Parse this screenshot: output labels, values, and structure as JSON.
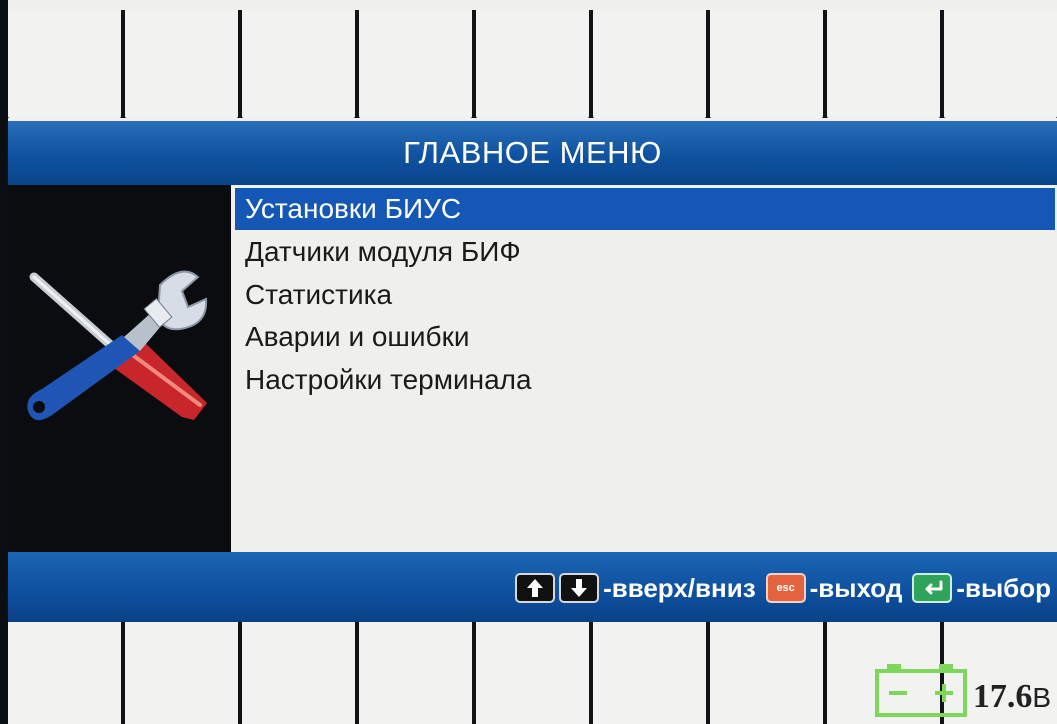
{
  "header": {
    "title": "ГЛАВНОЕ МЕНЮ"
  },
  "menu": {
    "items": [
      {
        "label": "Установки БИУС",
        "selected": true
      },
      {
        "label": "Датчики модуля БИФ",
        "selected": false
      },
      {
        "label": "Статистика",
        "selected": false
      },
      {
        "label": "Аварии и ошибки",
        "selected": false
      },
      {
        "label": "Настройки терминала",
        "selected": false
      }
    ]
  },
  "icon": {
    "name": "tools-icon"
  },
  "hints": {
    "updown_label": "-вверх/вниз",
    "esc_key": "esc",
    "exit_label": "-выход",
    "select_label": "-выбор"
  },
  "status": {
    "battery_voltage": "17.6",
    "battery_unit": "В"
  },
  "colors": {
    "accent": "#1457b5",
    "title_bar": "#0f52a0",
    "battery": "#7ed65a",
    "esc_key": "#e4633f",
    "enter_key": "#2ea35a"
  }
}
